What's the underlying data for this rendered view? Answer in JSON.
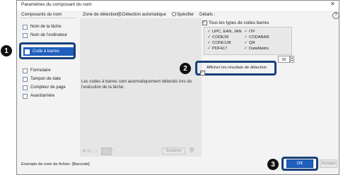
{
  "window": {
    "title": "Paramètres du composant du nom",
    "close_glyph": "✕",
    "help_glyph": "?"
  },
  "sidebar": {
    "heading": "Composants du nom",
    "items": [
      {
        "label": "Nom de la tâche"
      },
      {
        "label": "Nom de l'ordinateur"
      },
      {
        "label": "Code à barres"
      },
      {
        "label": "Formulaire"
      },
      {
        "label": "Tampon de date"
      },
      {
        "label": "Compteur de page"
      },
      {
        "label": "Avant/arrière"
      }
    ]
  },
  "detection": {
    "label": "Zone de détection:",
    "auto_label": "Détection automatique",
    "specify_label": "Spécifier"
  },
  "preview": {
    "message": "Les codes à barres sont automatiquement détectés lors de l'exécution de la tâche.",
    "scan_button": "Scanner"
  },
  "details": {
    "label": "Détails :",
    "all_types_label": "Tous les types de codes barres",
    "codes_left": [
      "UPC, EAN, JAN",
      "CODE39",
      "CODE128",
      "PDF417"
    ],
    "codes_right": [
      "ITF",
      "CODABAR",
      "QR",
      "DataMatrix"
    ],
    "spin_value": "30",
    "show_results_label": "Afficher les résultats de détection"
  },
  "footer": {
    "example_label": "Exemple de nom de fichier: [Barcode]",
    "ok_label": "OK",
    "cancel_label": "Annuler"
  },
  "callouts": {
    "one": "1",
    "two": "2",
    "three": "3"
  }
}
